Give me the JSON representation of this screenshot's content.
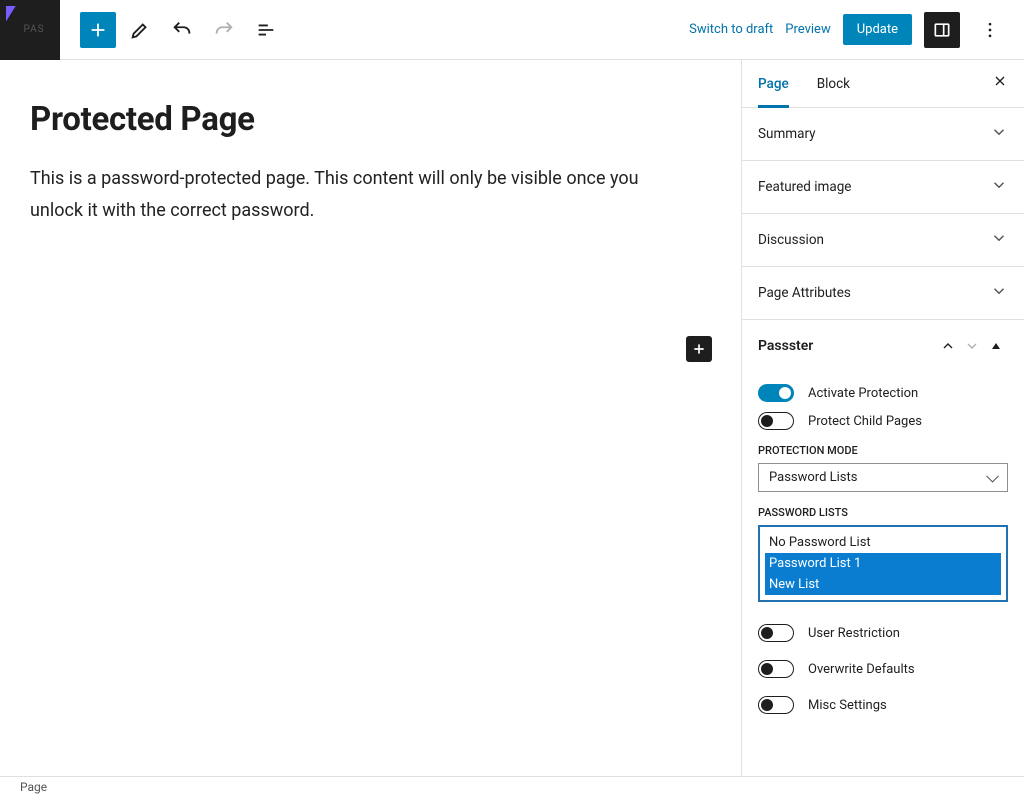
{
  "toolbar": {
    "switch_to_draft": "Switch to draft",
    "preview": "Preview",
    "update": "Update"
  },
  "content": {
    "title": "Protected Page",
    "body": "This is a password-protected page. This content will only be visible once you unlock it with the correct password."
  },
  "sidebar": {
    "tabs": {
      "page": "Page",
      "block": "Block"
    },
    "panels": {
      "summary": "Summary",
      "featured_image": "Featured image",
      "discussion": "Discussion",
      "page_attributes": "Page Attributes"
    },
    "passster": {
      "title": "Passster",
      "activate_protection": "Activate Protection",
      "protect_child_pages": "Protect Child Pages",
      "protection_mode_label": "PROTECTION MODE",
      "protection_mode_value": "Password Lists",
      "password_lists_label": "PASSWORD LISTS",
      "options": {
        "none": "No Password List",
        "list1": "Password List 1",
        "newlist": "New List"
      },
      "user_restriction": "User Restriction",
      "overwrite_defaults": "Overwrite Defaults",
      "misc_settings": "Misc Settings"
    }
  },
  "footer": {
    "breadcrumb": "Page"
  }
}
